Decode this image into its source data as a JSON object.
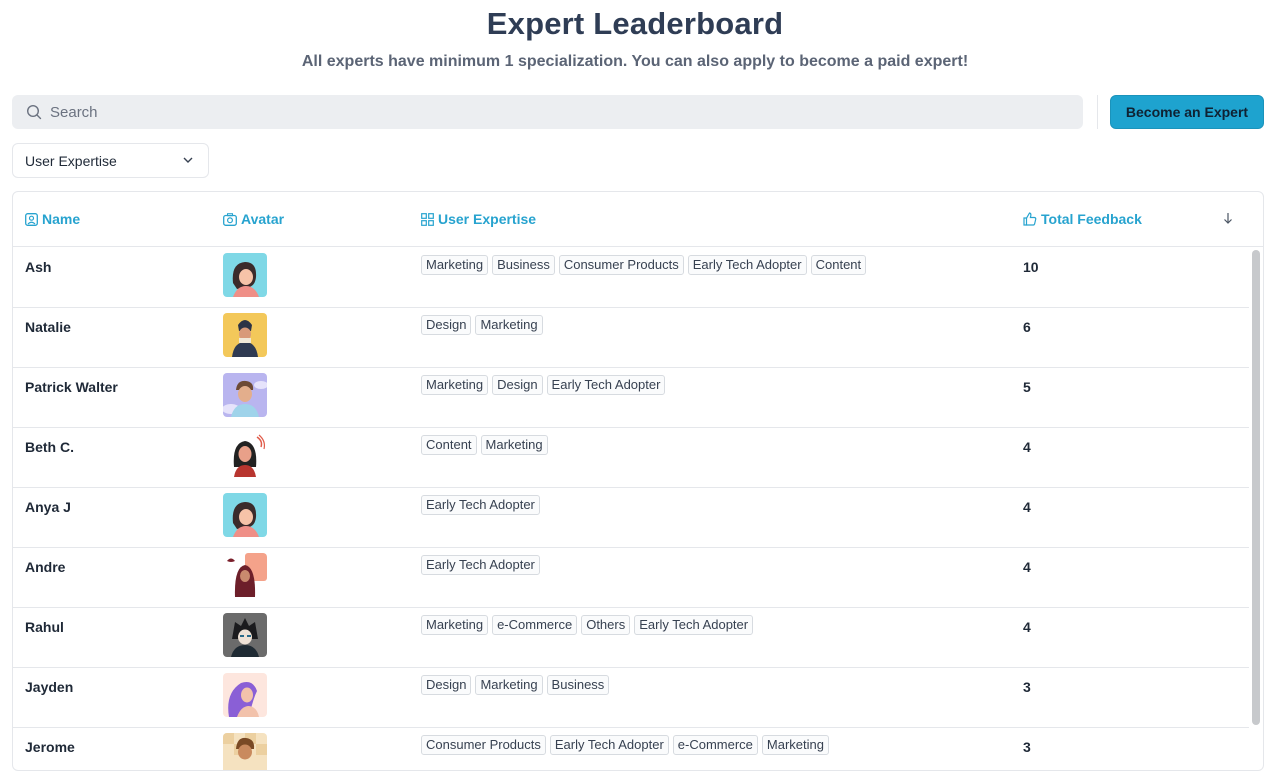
{
  "header": {
    "title": "Expert Leaderboard",
    "subtitle": "All experts have minimum 1 specialization. You can also apply to become a paid expert!"
  },
  "search": {
    "placeholder": "Search",
    "value": ""
  },
  "become_button_label": "Become an Expert",
  "filter": {
    "selected": "User Expertise"
  },
  "columns": {
    "name": "Name",
    "avatar": "Avatar",
    "expertise": "User Expertise",
    "total": "Total Feedback"
  },
  "colors": {
    "accent": "#27a3cf",
    "button_bg": "#1ea3cf"
  },
  "rows": [
    {
      "name": "Ash",
      "avatar_icon": "woman-avatar-teal",
      "tags": [
        "Marketing",
        "Business",
        "Consumer Products",
        "Early Tech Adopter",
        "Content"
      ],
      "total": "10"
    },
    {
      "name": "Natalie",
      "avatar_icon": "person-avatar-yellow",
      "tags": [
        "Design",
        "Marketing"
      ],
      "total": "6"
    },
    {
      "name": "Patrick Walter",
      "avatar_icon": "man-avatar-purple",
      "tags": [
        "Marketing",
        "Design",
        "Early Tech Adopter"
      ],
      "total": "5"
    },
    {
      "name": "Beth C.",
      "avatar_icon": "woman-avatar-red",
      "tags": [
        "Content",
        "Marketing"
      ],
      "total": "4"
    },
    {
      "name": "Anya J",
      "avatar_icon": "woman-avatar-teal",
      "tags": [
        "Early Tech Adopter"
      ],
      "total": "4"
    },
    {
      "name": "Andre",
      "avatar_icon": "hoodie-avatar-maroon",
      "tags": [
        "Early Tech Adopter"
      ],
      "total": "4"
    },
    {
      "name": "Rahul",
      "avatar_icon": "anime-avatar-gray",
      "tags": [
        "Marketing",
        "e-Commerce",
        "Others",
        "Early Tech Adopter"
      ],
      "total": "4"
    },
    {
      "name": "Jayden",
      "avatar_icon": "woman-avatar-purple-hair",
      "tags": [
        "Design",
        "Marketing",
        "Business"
      ],
      "total": "3"
    },
    {
      "name": "Jerome",
      "avatar_icon": "man-avatar-checker",
      "tags": [
        "Consumer Products",
        "Early Tech Adopter",
        "e-Commerce",
        "Marketing"
      ],
      "total": "3"
    }
  ]
}
